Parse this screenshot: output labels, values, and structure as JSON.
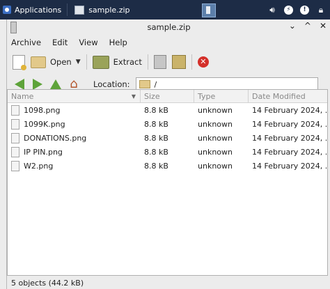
{
  "panel": {
    "applications_label": "Applications",
    "task_label": "sample.zip"
  },
  "window": {
    "title": "sample.zip",
    "controls": [
      "⌄",
      "^",
      "✕"
    ]
  },
  "menu": [
    "Archive",
    "Edit",
    "View",
    "Help"
  ],
  "toolbar": {
    "open_label": "Open",
    "extract_label": "Extract"
  },
  "location": {
    "label": "Location:",
    "value": "/"
  },
  "table": {
    "columns": [
      "Name",
      "Size",
      "Type",
      "Date Modified"
    ],
    "rows": [
      {
        "name": "1098.png",
        "size": "8.8 kB",
        "type": "unknown",
        "date": "14 February 2024, ..."
      },
      {
        "name": "1099K.png",
        "size": "8.8 kB",
        "type": "unknown",
        "date": "14 February 2024, ..."
      },
      {
        "name": "DONATIONS.png",
        "size": "8.8 kB",
        "type": "unknown",
        "date": "14 February 2024, ..."
      },
      {
        "name": "IP PIN.png",
        "size": "8.8 kB",
        "type": "unknown",
        "date": "14 February 2024, ..."
      },
      {
        "name": "W2.png",
        "size": "8.8 kB",
        "type": "unknown",
        "date": "14 February 2024, ..."
      }
    ]
  },
  "status": "5 objects (44.2 kB)",
  "colors": {
    "panel": "#1d2c46",
    "nav_arrow": "#5ea33a",
    "stop": "#d4302a"
  }
}
